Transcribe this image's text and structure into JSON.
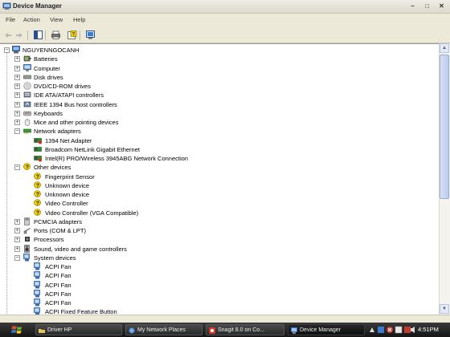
{
  "window": {
    "title": "Device Manager"
  },
  "menu": [
    "File",
    "Action",
    "View",
    "Help"
  ],
  "tree": {
    "root": "NGUYENNGOCANH",
    "items": [
      {
        "label": "Batteries",
        "icon": "battery-icon",
        "expanded": false
      },
      {
        "label": "Computer",
        "icon": "computer-icon",
        "expanded": false
      },
      {
        "label": "Disk drives",
        "icon": "disk-drive-icon",
        "expanded": false
      },
      {
        "label": "DVD/CD-ROM drives",
        "icon": "dvd-drive-icon",
        "expanded": false
      },
      {
        "label": "IDE ATA/ATAPI controllers",
        "icon": "ide-controller-icon",
        "expanded": false
      },
      {
        "label": "IEEE 1394 Bus host controllers",
        "icon": "ieee1394-icon",
        "expanded": false
      },
      {
        "label": "Keyboards",
        "icon": "keyboard-icon",
        "expanded": false
      },
      {
        "label": "Mice and other pointing devices",
        "icon": "mouse-icon",
        "expanded": false
      },
      {
        "label": "Network adapters",
        "icon": "network-adapter-icon",
        "expanded": true,
        "children": [
          {
            "label": "1394 Net Adapter",
            "icon": "network-card-warning-icon"
          },
          {
            "label": "Broadcom NetLink Gigabit Ethernet",
            "icon": "network-card-icon"
          },
          {
            "label": "Intel(R) PRO/Wireless 3945ABG Network Connection",
            "icon": "network-card-warning-icon"
          }
        ]
      },
      {
        "label": "Other devices",
        "icon": "unknown-device-icon",
        "expanded": true,
        "children": [
          {
            "label": "Fingerprint Sensor",
            "icon": "unknown-device-icon"
          },
          {
            "label": "Unknown device",
            "icon": "unknown-device-icon"
          },
          {
            "label": "Unknown device",
            "icon": "unknown-device-icon"
          },
          {
            "label": "Video Controller",
            "icon": "unknown-device-icon"
          },
          {
            "label": "Video Controller (VGA Compatible)",
            "icon": "unknown-device-icon"
          }
        ]
      },
      {
        "label": "PCMCIA adapters",
        "icon": "pcmcia-icon",
        "expanded": false
      },
      {
        "label": "Ports (COM & LPT)",
        "icon": "port-icon",
        "expanded": false
      },
      {
        "label": "Processors",
        "icon": "processor-icon",
        "expanded": false
      },
      {
        "label": "Sound, video and game controllers",
        "icon": "sound-icon",
        "expanded": false
      },
      {
        "label": "System devices",
        "icon": "system-device-icon",
        "expanded": true,
        "children": [
          {
            "label": "ACPI Fan",
            "icon": "system-device-icon"
          },
          {
            "label": "ACPI Fan",
            "icon": "system-device-icon"
          },
          {
            "label": "ACPI Fan",
            "icon": "system-device-icon"
          },
          {
            "label": "ACPI Fan",
            "icon": "system-device-icon"
          },
          {
            "label": "ACPI Fan",
            "icon": "system-device-icon"
          },
          {
            "label": "ACPI Fixed Feature Button",
            "icon": "system-device-icon"
          }
        ]
      }
    ]
  },
  "taskbar": {
    "tasks": [
      {
        "label": "Driver HP",
        "icon": "folder-icon",
        "active": false
      },
      {
        "label": "My Network Places",
        "icon": "network-places-icon",
        "active": false
      },
      {
        "label": "Snagit 8.0 on Co...",
        "icon": "snagit-icon",
        "active": false
      },
      {
        "label": "Device Manager",
        "icon": "device-manager-icon",
        "active": true
      }
    ],
    "clock": "4:51PM"
  },
  "colors": {
    "tree_bg": "#ffffff",
    "chrome": "#ece9d8",
    "taskbar": "#1c1c1c",
    "warning": "#f5d000"
  }
}
